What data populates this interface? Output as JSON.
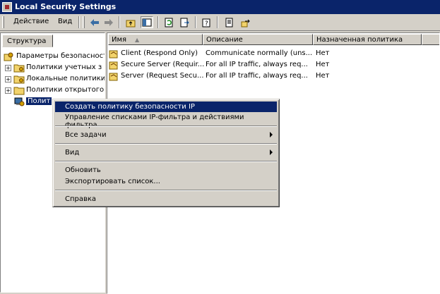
{
  "window": {
    "title": "Local Security Settings"
  },
  "menu": {
    "action": "Действие",
    "view": "Вид"
  },
  "toolbar_icons": [
    "back-arrow-icon",
    "forward-arrow-icon",
    "up-folder-icon",
    "show-hide-tree-icon",
    "refresh-icon",
    "export-list-icon",
    "help-icon",
    "add-policy-icon",
    "manage-filter-icon"
  ],
  "tree": {
    "tab_label": "Структура",
    "items": [
      {
        "label": "Параметры безопасност",
        "icon": "security-settings-icon"
      },
      {
        "label": "Политики учетных з",
        "icon": "folder-icon"
      },
      {
        "label": "Локальные политики",
        "icon": "folder-icon"
      },
      {
        "label": "Политики открытого",
        "icon": "folder-icon"
      },
      {
        "label": "Полит",
        "icon": "ip-security-icon"
      }
    ]
  },
  "list": {
    "columns": [
      "Имя",
      "Описание",
      "Назначенная политика"
    ],
    "rows": [
      {
        "name": "Client (Respond Only)",
        "description": "Communicate normally (uns...",
        "assigned": "Нет"
      },
      {
        "name": "Secure Server (Requir...",
        "description": "For all IP traffic, always req...",
        "assigned": "Нет"
      },
      {
        "name": "Server (Request Secu...",
        "description": "For all IP traffic, always req...",
        "assigned": "Нет"
      }
    ]
  },
  "context_menu": {
    "items": [
      {
        "label": "Создать политику безопасности IP",
        "highlighted": true
      },
      {
        "label": "Управление списками IP-фильтра и действиями фильтра"
      },
      {
        "label": "Все задачи",
        "submenu": true
      },
      {
        "label": "Вид",
        "submenu": true
      },
      {
        "label": "Обновить"
      },
      {
        "label": "Экспортировать список..."
      },
      {
        "label": "Справка"
      }
    ]
  },
  "colors": {
    "title_bar": "#0a246a",
    "highlight": "#0a246a",
    "face": "#d4d0c8"
  }
}
